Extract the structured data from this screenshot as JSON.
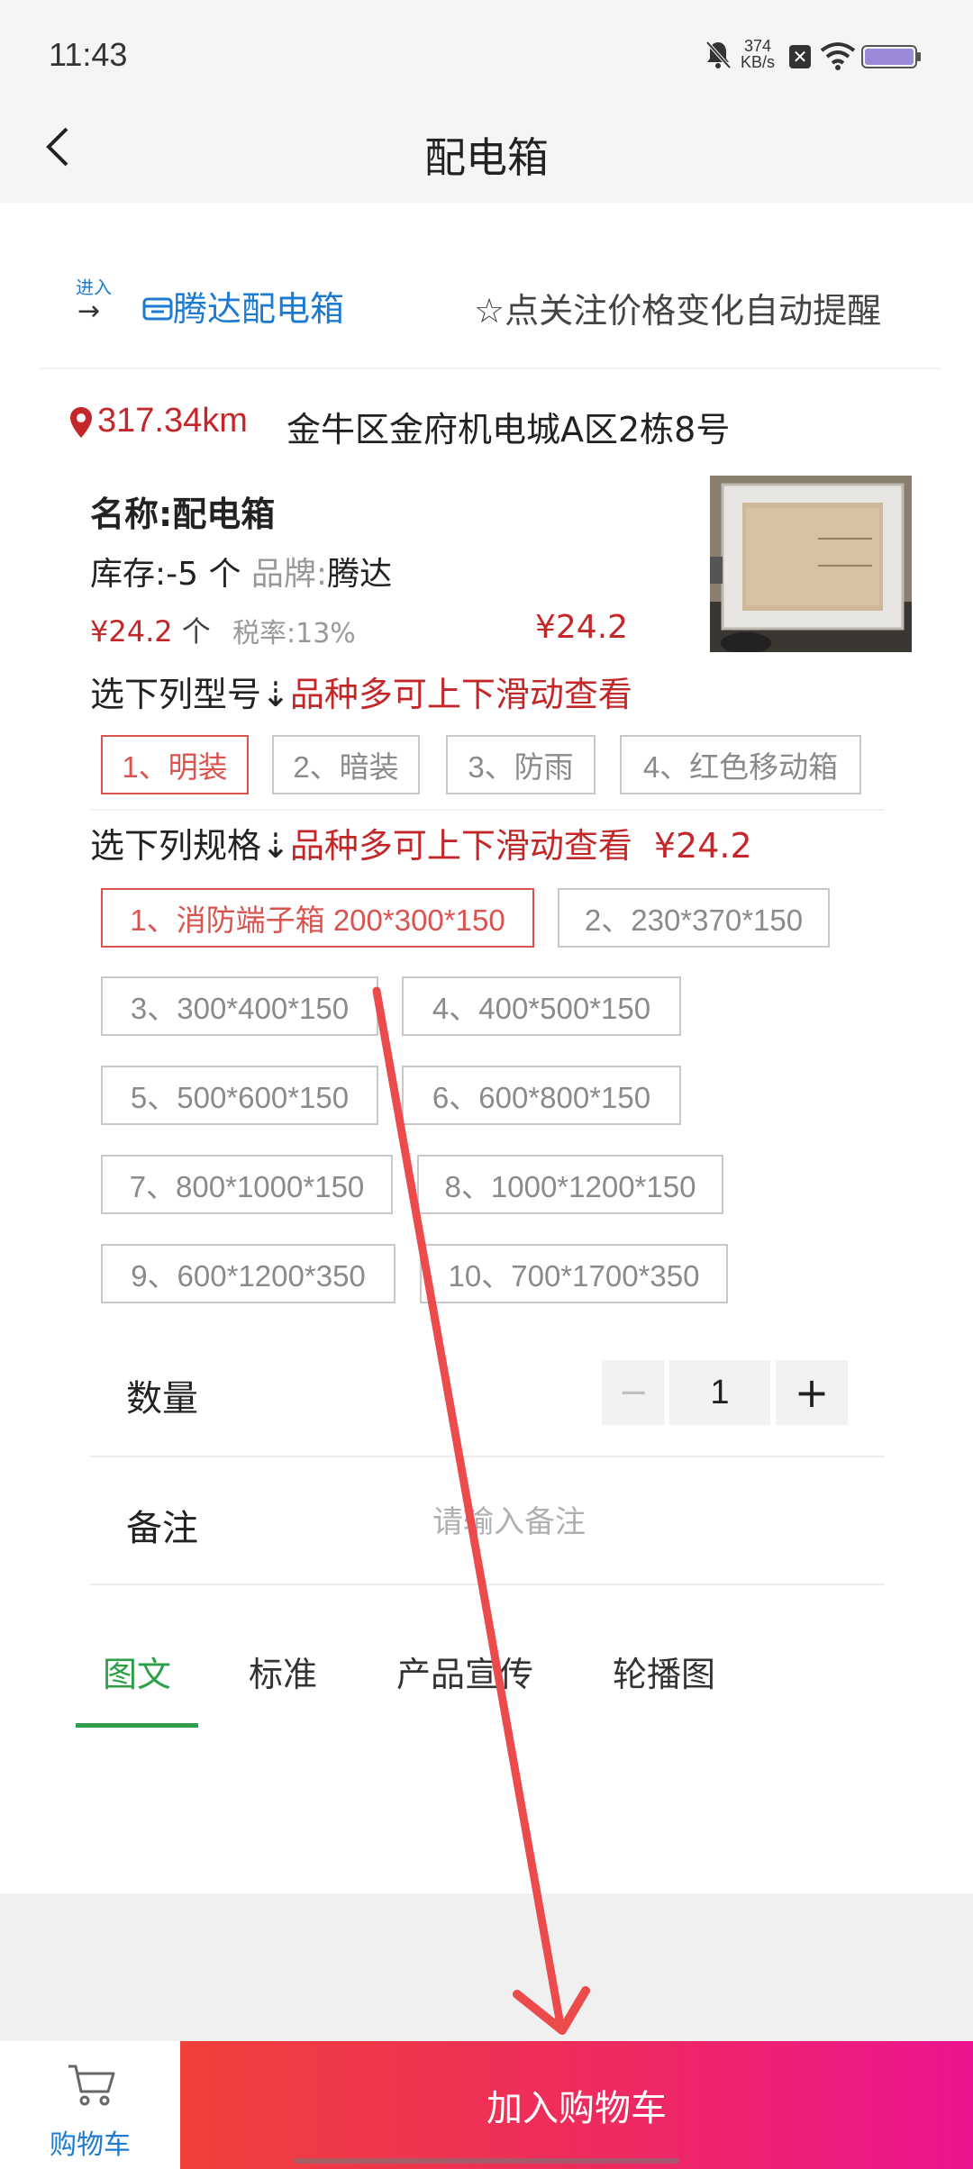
{
  "status_bar": {
    "time": "11:43",
    "net_speed_value": "374",
    "net_speed_unit": "KB/s"
  },
  "nav": {
    "title": "配电箱"
  },
  "store": {
    "enter_label": "进入",
    "enter_arrow": "→",
    "name": "腾达配电箱",
    "follow_text": "☆点关注价格变化自动提醒"
  },
  "location": {
    "distance": "317.34km",
    "address": "金牛区金府机电城A区2栋8号"
  },
  "product": {
    "name": "名称:配电箱",
    "stock": "库存:-5 个",
    "brand_label": "品牌:",
    "brand": "腾达",
    "price": "¥24.2",
    "unit": "个",
    "tax": "税率:13%",
    "price_right": "¥24.2"
  },
  "model_section": {
    "title": "选下列型号⇣",
    "hint": "品种多可上下滑动查看"
  },
  "models": [
    "1、明装",
    "2、暗装",
    "3、防雨",
    "4、红色移动箱"
  ],
  "spec_section": {
    "title": "选下列规格⇣",
    "hint": "品种多可上下滑动查看",
    "price": "¥24.2"
  },
  "specs": [
    "1、消防端子箱 200*300*150",
    "2、230*370*150",
    "3、300*400*150",
    "4、400*500*150",
    "5、500*600*150",
    "6、600*800*150",
    "7、800*1000*150",
    "8、1000*1200*150",
    "9、600*1200*350",
    "10、700*1700*350"
  ],
  "quantity": {
    "label": "数量",
    "minus": "−",
    "value": "1",
    "plus": "+"
  },
  "remark": {
    "label": "备注",
    "placeholder": "请输入备注"
  },
  "tabs": [
    "图文",
    "标准",
    "产品宣传",
    "轮播图"
  ],
  "bottom": {
    "cart_label": "购物车",
    "add_to_cart": "加入购物车"
  },
  "colors": {
    "accent_red": "#c4272a",
    "link_blue": "#1c7bd0",
    "tab_green": "#2e9e48",
    "button_gradient_start": "#f0403a",
    "button_gradient_end": "#ec1490"
  }
}
